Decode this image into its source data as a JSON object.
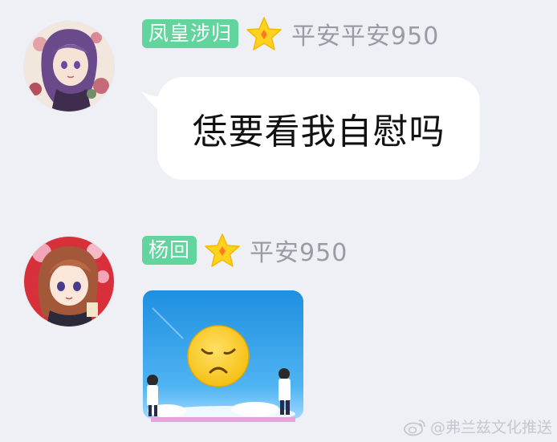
{
  "messages": [
    {
      "sender_tag": "凤皇涉归",
      "sender_name": "平安平安950",
      "text": "恁要看我自慰吗"
    },
    {
      "sender_tag": "杨回",
      "sender_name": "平安950",
      "image_content": "sad-face-emoji-sticker"
    }
  ],
  "watermark": {
    "text": "@弗兰兹文化推送",
    "icon": "weibo-icon"
  },
  "colors": {
    "background": "#eef0f5",
    "tag_badge": "#62d49d",
    "star": "#ffd21f",
    "nickname": "#9a9ca4",
    "bubble": "#ffffff"
  }
}
